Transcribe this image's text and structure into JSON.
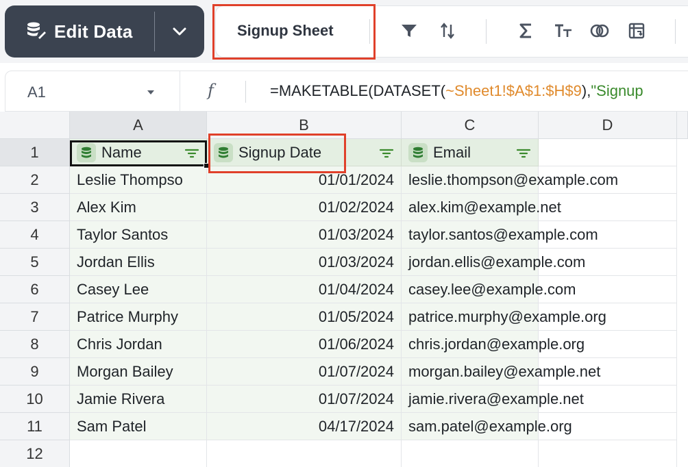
{
  "toolbar": {
    "edit_label": "Edit Data",
    "sheet_tab": "Signup Sheet",
    "icons": [
      "filter-icon",
      "sort-icon",
      "sum-icon",
      "text-format-icon",
      "join-icon",
      "pivot-icon"
    ]
  },
  "formula_bar": {
    "cell_ref": "A1",
    "fx": "f",
    "formula_prefix": "=MAKETABLE(DATASET(",
    "formula_ref": "~Sheet1!$A$1:$H$9",
    "formula_mid": "),",
    "formula_str": "\"Signup"
  },
  "columns": [
    "A",
    "B",
    "C",
    "D"
  ],
  "rows": [
    "1",
    "2",
    "3",
    "4",
    "5",
    "6",
    "7",
    "8",
    "9",
    "10",
    "11",
    "12"
  ],
  "headers": [
    "Name",
    "Signup Date",
    "Email"
  ],
  "data": [
    [
      "Leslie Thompso",
      "01/01/2024",
      "leslie.thompson@example.com"
    ],
    [
      "Alex Kim",
      "01/02/2024",
      "alex.kim@example.net"
    ],
    [
      "Taylor Santos",
      "01/03/2024",
      "taylor.santos@example.com"
    ],
    [
      "Jordan Ellis",
      "01/03/2024",
      "jordan.ellis@example.com"
    ],
    [
      "Casey Lee",
      "01/04/2024",
      "casey.lee@example.com"
    ],
    [
      "Patrice Murphy",
      "01/05/2024",
      "patrice.murphy@example.org"
    ],
    [
      "Chris Jordan",
      "01/06/2024",
      "chris.jordan@example.org"
    ],
    [
      "Morgan Bailey",
      "01/07/2024",
      "morgan.bailey@example.net"
    ],
    [
      "Jamie Rivera",
      "01/07/2024",
      "jamie.rivera@example.net"
    ],
    [
      "Sam Patel",
      "04/17/2024",
      "sam.patel@example.org"
    ]
  ],
  "colors": {
    "accent_highlight": "#e0402a",
    "table_header": "#e4efe2",
    "table_body": "#f2f7f1",
    "toolbar_dark": "#3b4350"
  }
}
